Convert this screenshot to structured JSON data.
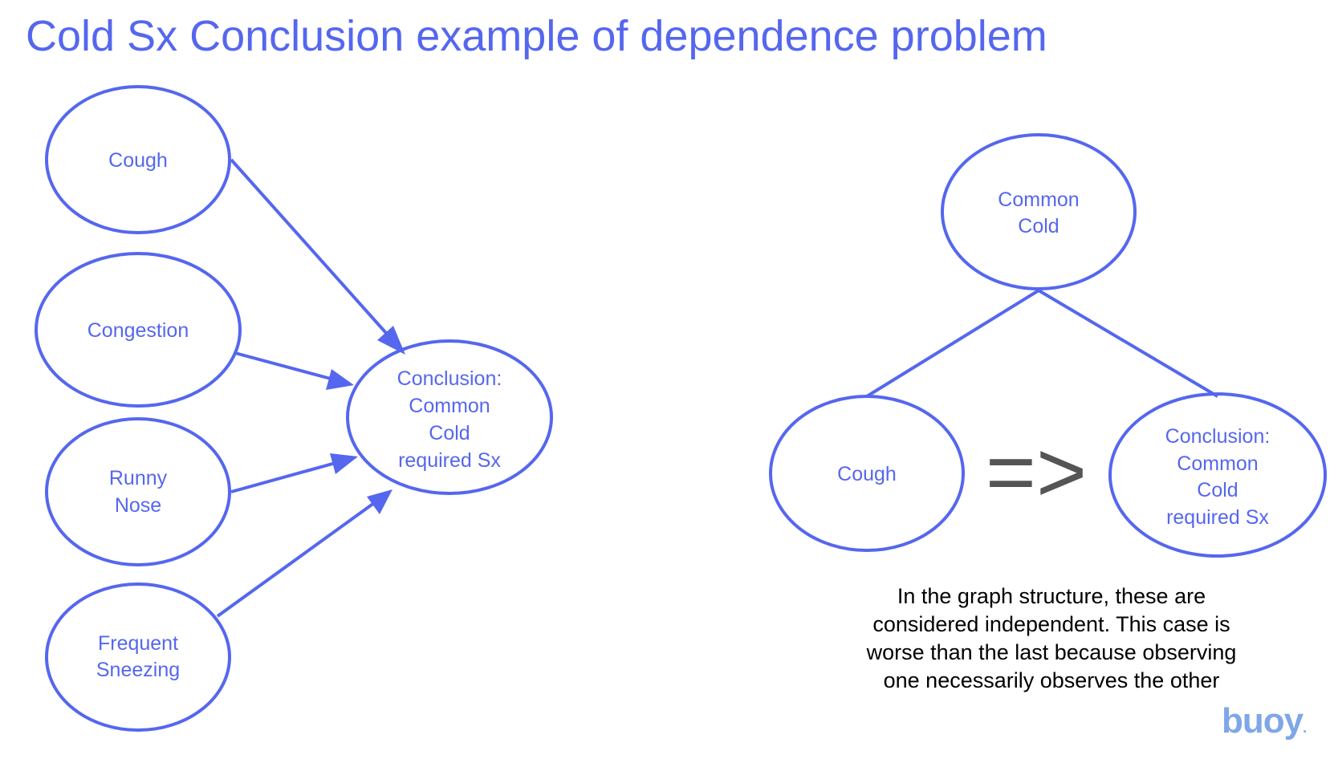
{
  "title": "Cold Sx Conclusion example of dependence problem",
  "colors": {
    "accent": "#5567ee",
    "arrow_text": "#555555",
    "caption_text": "#000000",
    "logo": "#7fa7e8"
  },
  "left_graph": {
    "symptoms": [
      {
        "lines": [
          "Cough"
        ]
      },
      {
        "lines": [
          "Congestion"
        ]
      },
      {
        "lines": [
          "Runny",
          "Nose"
        ]
      },
      {
        "lines": [
          "Frequent",
          "Sneezing"
        ]
      }
    ],
    "conclusion": {
      "lines": [
        "Conclusion:",
        "Common",
        "Cold",
        "required Sx"
      ]
    }
  },
  "right_graph": {
    "parent": {
      "lines": [
        "Common",
        "Cold"
      ]
    },
    "left_child": {
      "lines": [
        "Cough"
      ]
    },
    "right_child": {
      "lines": [
        "Conclusion:",
        "Common",
        "Cold",
        "required Sx"
      ]
    },
    "implies_symbol": "=>"
  },
  "caption_lines": [
    "In the graph structure, these are",
    "considered independent. This case is",
    "worse than the last because observing",
    "one necessarily observes the other"
  ],
  "logo_text": "buoy",
  "logo_mark": "."
}
